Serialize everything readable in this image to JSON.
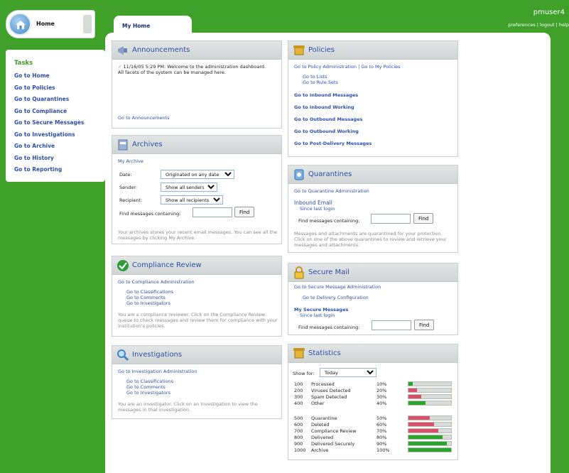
{
  "home": {
    "label": "Home"
  },
  "tasks": {
    "title": "Tasks",
    "items": [
      "Go to Home",
      "Go to Policies",
      "Go to Quarantines",
      "Go to Compliance",
      "Go to Secure Messages",
      "Go to Investigations",
      "Go to Archive",
      "Go to History",
      "Go to Reporting"
    ]
  },
  "user": {
    "name": "pmuser4",
    "links": "preferences | logout | help"
  },
  "tab": {
    "label": "My Home"
  },
  "announcements": {
    "title": "Announcements",
    "message": "11/16/05 5:29 PM: Welcome to the administration dashboard. All facets of the system can be managed here.",
    "link": "Go to Announcements"
  },
  "archives": {
    "title": "Archives",
    "link": "My Archive",
    "date_label": "Date:",
    "date_value": "Originated on any date",
    "sender_label": "Sender:",
    "sender_value": "Show all senders",
    "recipient_label": "Recipient:",
    "recipient_value": "Show all recipients",
    "find_label": "Find messages containing:",
    "find_button": "Find",
    "desc": "Your archives stores your recent email messages. You can see all the messages by clicking My Archive."
  },
  "compliance": {
    "title": "Compliance Review",
    "admin_link": "Go to Compliance Administration",
    "links": [
      "Go to Classifications",
      "Go to Comments",
      "Go to Investigators"
    ],
    "desc": "You are a compliance reviewer. Click on the Compliance Review queue to check messages and review them for compliance with your institution's policies."
  },
  "investigations": {
    "title": "Investigations",
    "admin_link": "Go to Investigation Administration",
    "links": [
      "Go to Classifications",
      "Go to Comments",
      "Go to Investigators"
    ],
    "desc": "You are an investigator. Click on an Investigation to view the messages in that investigation."
  },
  "policies": {
    "title": "Policies",
    "top_links": "Go to Policy Administration | Go to My Policies",
    "sub_links": [
      "Go to Lists",
      "Go to Rule Sets"
    ],
    "links": [
      "Go to Inbound Messages",
      "Go to Inbound Working",
      "Go to Outbound Messages",
      "Go to Outbound Working",
      "Go to Post-Delivery Messages"
    ]
  },
  "quarantines": {
    "title": "Quarantines",
    "admin_link": "Go to Quarantine Administration",
    "inbound": "Inbound Email",
    "since": "Since last login",
    "find_label": "Find messages containing:",
    "find_button": "Find",
    "desc": "Messages and attachments are quarantined for your protection. Click on one of the above quarantines to review and retrieve your messages and attachments."
  },
  "secure_mail": {
    "title": "Secure Mail",
    "admin_link": "Go to Secure Message Administration",
    "delivery_link": "Go to Delivery Configuration",
    "my_messages": "My Secure Messages",
    "since": "Since last login",
    "find_label": "Find messages containing:",
    "find_button": "Find"
  },
  "statistics": {
    "title": "Statistics",
    "show_for_label": "Show for:",
    "show_for_value": "Today",
    "rows": [
      {
        "n": "100",
        "label": "Processed",
        "pct": "10%",
        "value": 0.1,
        "color": "#2aa52a"
      },
      {
        "n": "200",
        "label": "Viruses Detected",
        "pct": "20%",
        "value": 0.2,
        "color": "#d9506a"
      },
      {
        "n": "300",
        "label": "Spam Detected",
        "pct": "30%",
        "value": 0.3,
        "color": "#d9506a"
      },
      {
        "n": "400",
        "label": "Other",
        "pct": "40%",
        "value": 0.4,
        "color": "#2aa52a"
      },
      {
        "n": "500",
        "label": "Quarantine",
        "pct": "50%",
        "value": 0.5,
        "color": "#d9506a"
      },
      {
        "n": "600",
        "label": "Deleted",
        "pct": "60%",
        "value": 0.6,
        "color": "#d9506a"
      },
      {
        "n": "700",
        "label": "Compliance Review",
        "pct": "70%",
        "value": 0.7,
        "color": "#d9506a"
      },
      {
        "n": "800",
        "label": "Delivered",
        "pct": "80%",
        "value": 0.8,
        "color": "#2aa52a"
      },
      {
        "n": "900",
        "label": "Delivered Securely",
        "pct": "90%",
        "value": 0.9,
        "color": "#2aa52a"
      },
      {
        "n": "1000",
        "label": "Archive",
        "pct": "100%",
        "value": 1.0,
        "color": "#2aa52a"
      }
    ]
  }
}
